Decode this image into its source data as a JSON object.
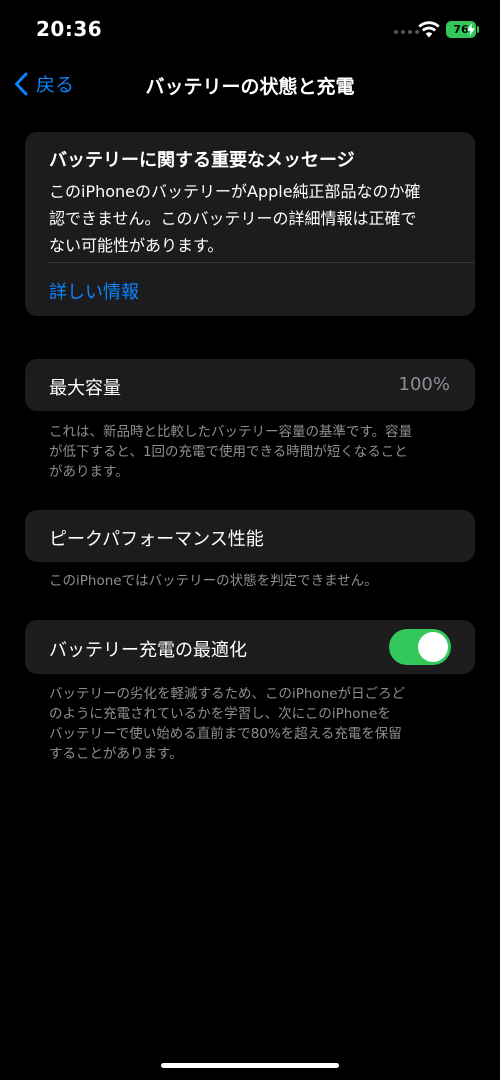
{
  "status_bar": {
    "time": "20:36",
    "battery_level": "76"
  },
  "nav": {
    "back_label": "戻る",
    "title": "バッテリーの状態と充電"
  },
  "message_card": {
    "title": "バッテリーに関する重要なメッセージ",
    "body_lines": [
      "このiPhoneのバッテリーがApple純正部品なのか確",
      "認できません。このバッテリーの詳細情報は正確で",
      "ない可能性があります。"
    ],
    "link": "詳しい情報"
  },
  "max_capacity": {
    "label": "最大容量",
    "value": "100%",
    "footnote_lines": [
      "これは、新品時と比較したバッテリー容量の基準です。容量",
      "が低下すると、1回の充電で使用できる時間が短くなること",
      "があります。"
    ]
  },
  "peak_performance": {
    "label": "ピークパフォーマンス性能",
    "footnote_lines": [
      "このiPhoneではバッテリーの状態を判定できません。"
    ]
  },
  "optimized_charging": {
    "label": "バッテリー充電の最適化",
    "enabled": true,
    "footnote_lines": [
      "バッテリーの劣化を軽減するため、このiPhoneが日ごろど",
      "のように充電されているかを学習し、次にこのiPhoneを",
      "バッテリーで使い始める直前まで80%を超える充電を保留",
      "することがあります。"
    ]
  },
  "colors": {
    "accent": "#0a84ff",
    "toggle_on": "#34c759",
    "card_bg": "#1c1c1e",
    "secondary_text": "#8e8e93"
  }
}
